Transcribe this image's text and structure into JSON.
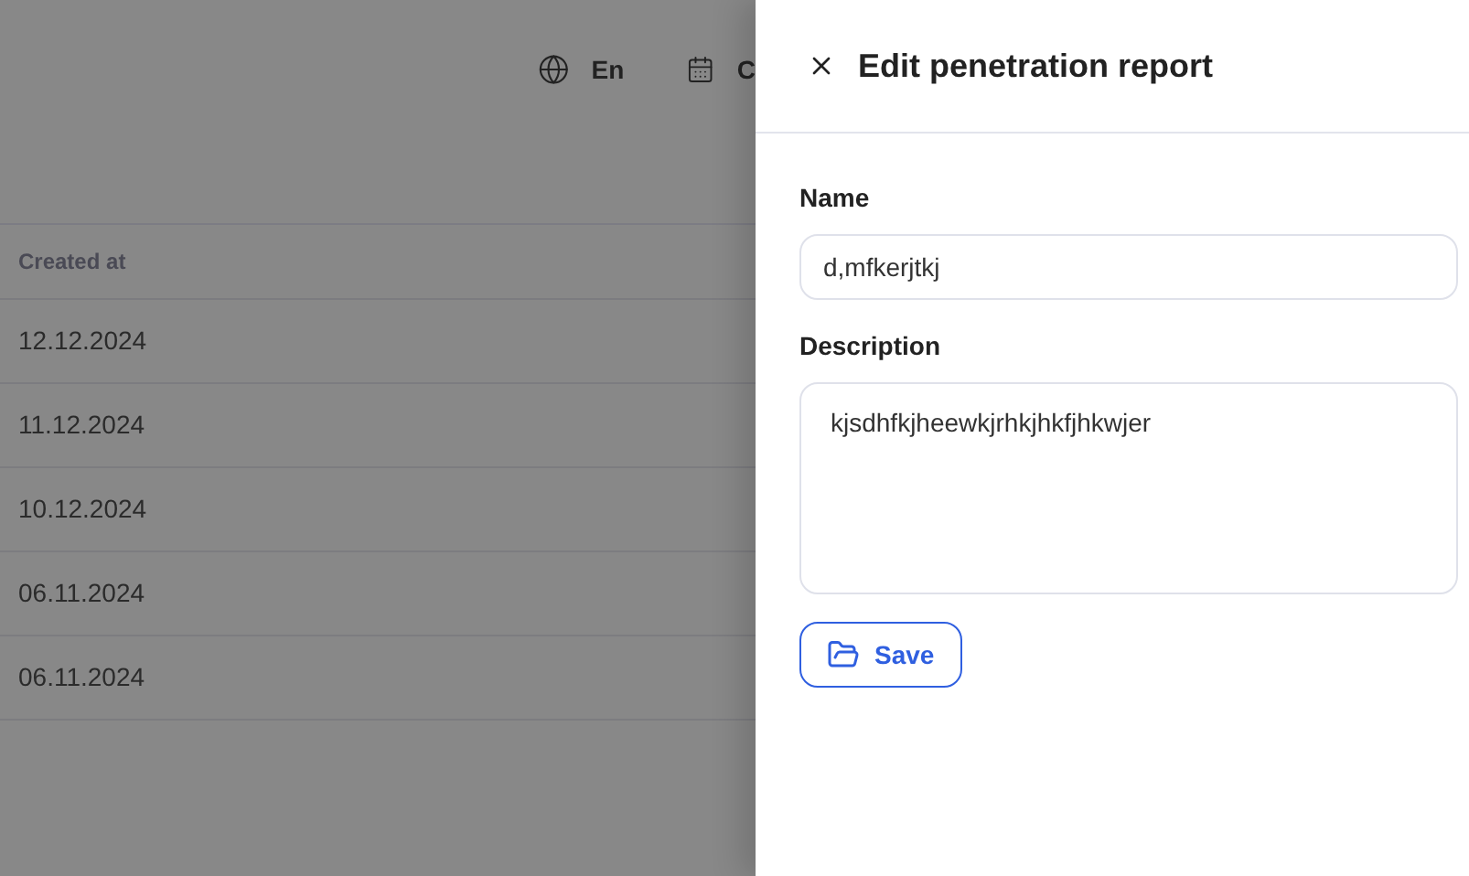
{
  "topbar": {
    "language": "En",
    "calendar_label": "C"
  },
  "table": {
    "columns": [
      "Created at"
    ],
    "rows": [
      [
        "12.12.2024"
      ],
      [
        "11.12.2024"
      ],
      [
        "10.12.2024"
      ],
      [
        "06.11.2024"
      ],
      [
        "06.11.2024"
      ]
    ]
  },
  "panel": {
    "title": "Edit penetration report",
    "fields": [
      {
        "kind": "input",
        "label": "Name",
        "value": "d,mfkerjtkj"
      },
      {
        "kind": "textarea",
        "label": "Description",
        "value": "kjsdhfkjheewkjrhkjhkfjhkwjer"
      }
    ],
    "save_button": "Save"
  }
}
